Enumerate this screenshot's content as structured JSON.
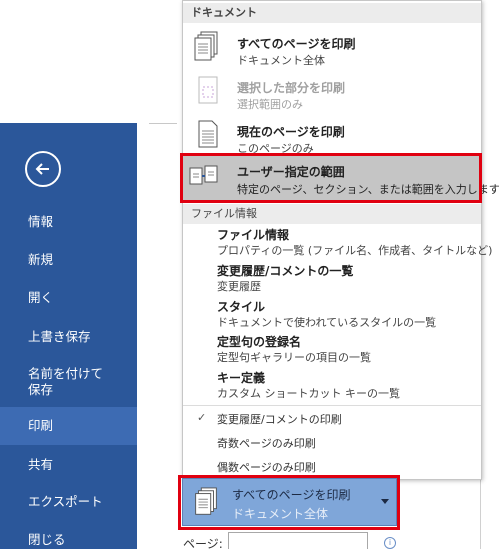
{
  "nav": {
    "items": [
      {
        "label": "情報"
      },
      {
        "label": "新規"
      },
      {
        "label": "開く"
      },
      {
        "label": "上書き保存"
      },
      {
        "label": "名前を付けて保存"
      },
      {
        "label": "印刷"
      },
      {
        "label": "共有"
      },
      {
        "label": "エクスポート"
      },
      {
        "label": "閉じる"
      }
    ],
    "active_item": "印刷",
    "back_icon": "arrow-left-circle-icon"
  },
  "menu": {
    "doc_header": "ドキュメント",
    "doc_options": [
      {
        "title": "すべてのページを印刷",
        "subtitle": "ドキュメント全体",
        "icon": "pages-stack-icon",
        "enabled": true
      },
      {
        "title": "選択した部分を印刷",
        "subtitle": "選択範囲のみ",
        "icon": "selection-page-icon",
        "enabled": false
      },
      {
        "title": "現在のページを印刷",
        "subtitle": "このページのみ",
        "icon": "single-page-icon",
        "enabled": true
      },
      {
        "title": "ユーザー指定の範囲",
        "subtitle": "特定のページ、セクション、または範囲を入力します",
        "icon": "custom-range-pages-icon",
        "enabled": true,
        "highlighted": true
      }
    ],
    "info_header": "ファイル情報",
    "info_options": [
      {
        "title": "ファイル情報",
        "subtitle": "プロパティの一覧 (ファイル名、作成者、タイトルなど)"
      },
      {
        "title": "変更履歴/コメントの一覧",
        "subtitle": "変更履歴"
      },
      {
        "title": "スタイル",
        "subtitle": "ドキュメントで使われているスタイルの一覧"
      },
      {
        "title": "定型句の登録名",
        "subtitle": "定型句ギャラリーの項目の一覧"
      },
      {
        "title": "キー定義",
        "subtitle": "カスタム ショートカット キーの一覧"
      }
    ],
    "toggles": [
      {
        "label": "変更履歴/コメントの印刷",
        "checked": true
      },
      {
        "label": "奇数ページのみ印刷",
        "checked": false
      },
      {
        "label": "偶数ページのみ印刷",
        "checked": false
      }
    ],
    "check_glyph": "✓"
  },
  "range_selector": {
    "title": "すべてのページを印刷",
    "subtitle": "ドキュメント全体",
    "icon": "pages-stack-icon"
  },
  "pages": {
    "label": "ページ:",
    "value": "",
    "info_glyph": "i"
  },
  "colors": {
    "nav_bg": "#2b579a",
    "nav_active": "#3d6bb3",
    "highlight_border": "#e00010",
    "selector_bg": "#7fa6d9"
  }
}
